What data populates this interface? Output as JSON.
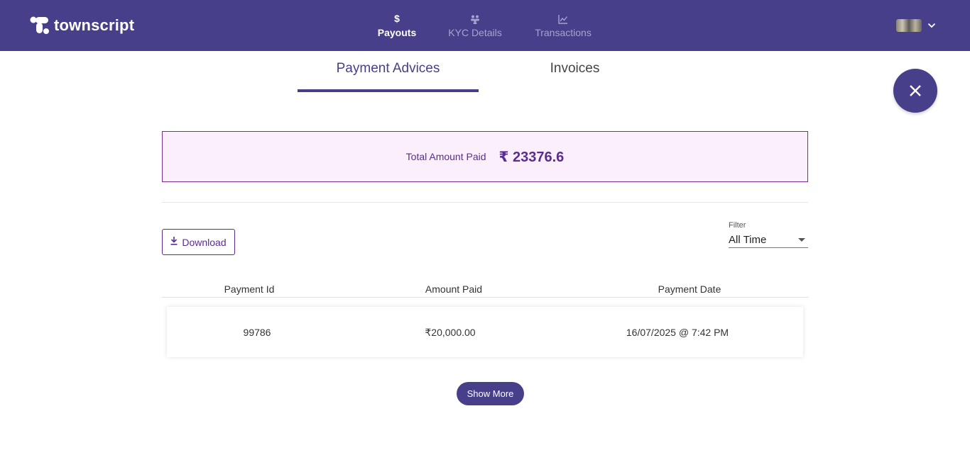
{
  "brand": {
    "name": "townscript"
  },
  "nav": {
    "items": [
      {
        "label": "Payouts",
        "icon": "dollar-icon",
        "active": true
      },
      {
        "label": "KYC Details",
        "icon": "users-icon",
        "active": false
      },
      {
        "label": "Transactions",
        "icon": "chart-line-icon",
        "active": false
      }
    ]
  },
  "tabs": [
    {
      "label": "Payment Advices",
      "active": true
    },
    {
      "label": "Invoices",
      "active": false
    }
  ],
  "summary": {
    "label": "Total Amount Paid",
    "value": "₹ 23376.6"
  },
  "toolbar": {
    "download_label": "Download"
  },
  "filter": {
    "label": "Filter",
    "value": "All Time"
  },
  "table": {
    "columns": [
      "Payment Id",
      "Amount Paid",
      "Payment Date"
    ],
    "rows": [
      {
        "payment_id": "99786",
        "amount": "₹20,000.00",
        "date": "16/07/2025 @ 7:42 PM"
      }
    ]
  },
  "show_more_label": "Show More",
  "colors": {
    "primary": "#483f8a",
    "accent": "#5a2c91",
    "summary_bg": "#fbeffc"
  }
}
